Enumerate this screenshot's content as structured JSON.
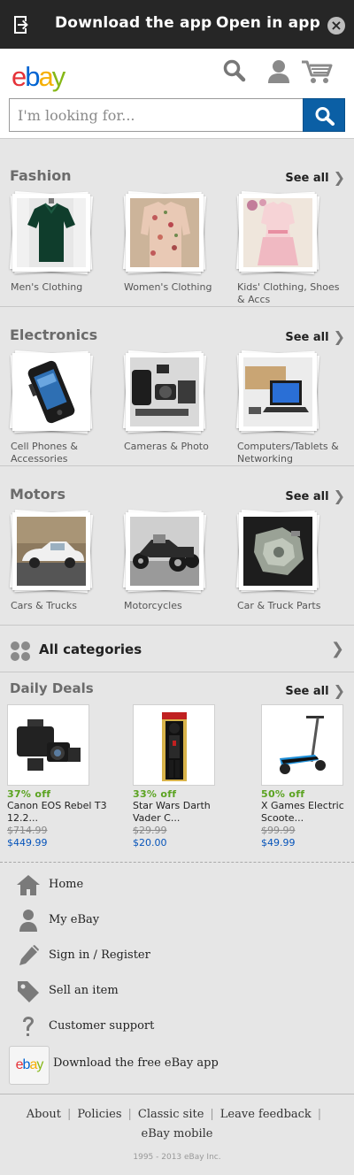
{
  "banner": {
    "download": "Download the app",
    "open": "Open in app",
    "close": "×"
  },
  "header": {
    "logo": [
      "e",
      "b",
      "a",
      "y"
    ],
    "search_placeholder": "I'm looking for..."
  },
  "sections": [
    {
      "title": "Fashion",
      "see_all": "See all",
      "tiles": [
        {
          "label": "Men's Clothing"
        },
        {
          "label": "Women's Clothing"
        },
        {
          "label": "Kids' Clothing, Shoes & Accs"
        }
      ]
    },
    {
      "title": "Electronics",
      "see_all": "See all",
      "tiles": [
        {
          "label": "Cell Phones & Accessories"
        },
        {
          "label": "Cameras & Photo"
        },
        {
          "label": "Computers/Tablets & Networking"
        }
      ]
    },
    {
      "title": "Motors",
      "see_all": "See all",
      "tiles": [
        {
          "label": "Cars & Trucks"
        },
        {
          "label": "Motorcycles"
        },
        {
          "label": "Car & Truck Parts"
        }
      ]
    }
  ],
  "all_categories": "All categories",
  "deals": {
    "title": "Daily Deals",
    "see_all": "See all",
    "items": [
      {
        "off": "37% off",
        "name": "Canon EOS Rebel T3 12.2...",
        "orig": "$714.99",
        "price": "$449.99"
      },
      {
        "off": "33% off",
        "name": "Star Wars Darth Vader C...",
        "orig": "$29.99",
        "price": "$20.00"
      },
      {
        "off": "50% off",
        "name": "X Games Electric Scoote...",
        "orig": "$99.99",
        "price": "$49.99"
      }
    ]
  },
  "bottom_nav": {
    "home": "Home",
    "my_ebay": "My eBay",
    "sign_in": "Sign in / Register",
    "sell": "Sell an item",
    "support": "Customer support",
    "download_app": "Download the free eBay app"
  },
  "footer": {
    "about": "About",
    "policies": "Policies",
    "classic": "Classic site",
    "feedback": "Leave feedback",
    "mobile": "eBay mobile",
    "copyright": "1995 - 2013 eBay Inc."
  },
  "colors": {
    "brand_red": "#e53238",
    "brand_blue": "#0064d2",
    "brand_yellow": "#f5af02",
    "brand_green": "#86b817",
    "search_button": "#0b5fa5",
    "deal_green": "#5ba321",
    "price_blue": "#0654ba"
  }
}
